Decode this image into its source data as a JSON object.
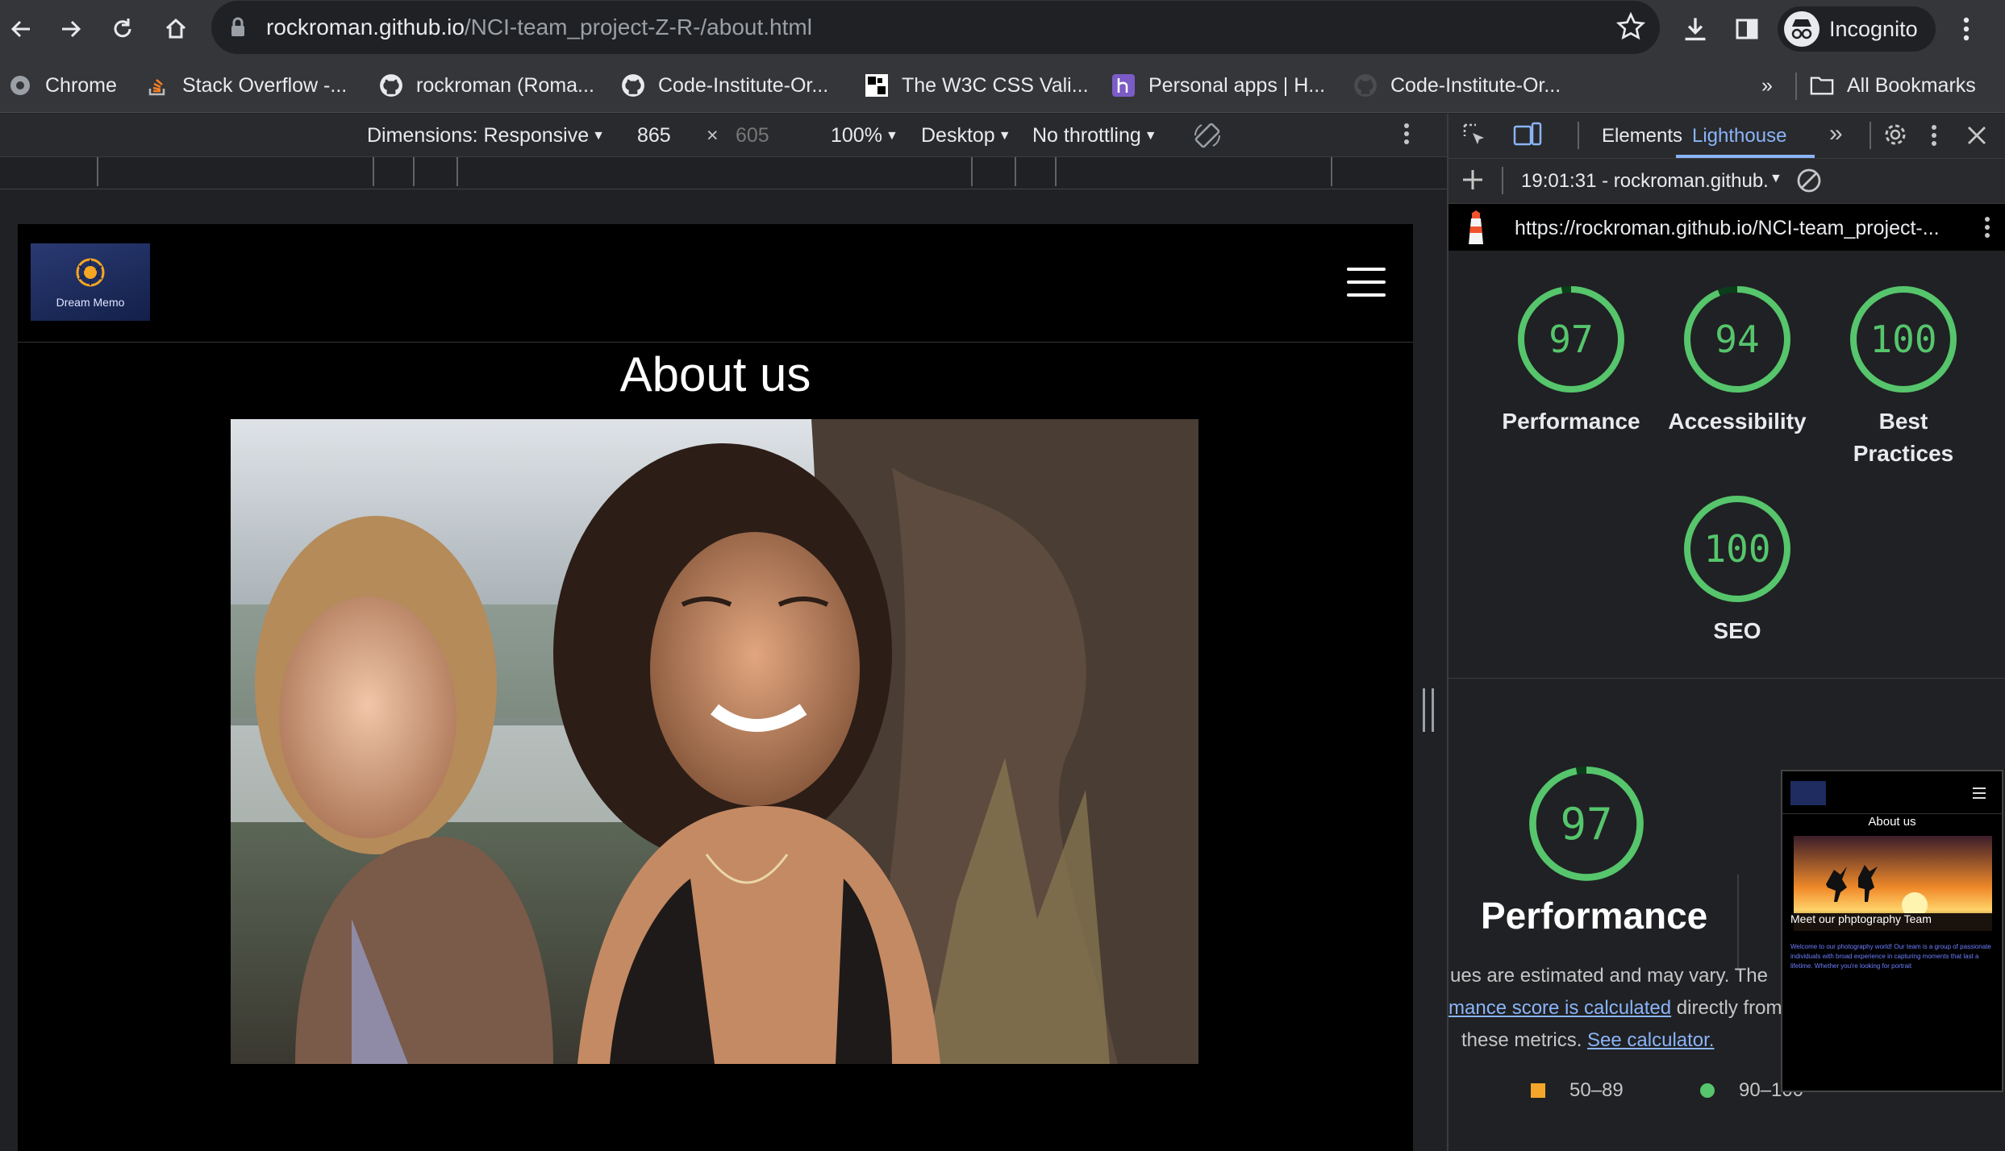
{
  "browser": {
    "url_domain": "rockroman.github.io",
    "url_path": "/NCI-team_project-Z-R-/about.html",
    "profile_label": "Incognito"
  },
  "bookmarks": {
    "items": [
      {
        "label": "Chrome",
        "icon": "chrome-icon"
      },
      {
        "label": "Stack Overflow -...",
        "icon": "stackoverflow-icon"
      },
      {
        "label": "rockroman (Roma...",
        "icon": "github-icon"
      },
      {
        "label": "Code-Institute-Or...",
        "icon": "github-icon"
      },
      {
        "label": "The W3C CSS Vali...",
        "icon": "w3c-icon"
      },
      {
        "label": "Personal apps | H...",
        "icon": "heroku-icon"
      },
      {
        "label": "Code-Institute-Or...",
        "icon": "github-icon"
      }
    ],
    "overflow": "»",
    "all_bookmarks": "All Bookmarks"
  },
  "device_toolbar": {
    "dimensions": "Dimensions: Responsive",
    "width": "865",
    "times": "×",
    "height": "605",
    "zoom": "100%",
    "device_type": "Desktop",
    "throttling": "No throttling"
  },
  "site": {
    "logo_text": "Dream Memo",
    "title": "About us"
  },
  "devtools": {
    "tabs": {
      "elements": "Elements",
      "lighthouse": "Lighthouse",
      "more": "»"
    },
    "report_time": "19:01:31 - rockroman.github.i",
    "report_url": "https://rockroman.github.io/NCI-team_project-...",
    "scores": [
      {
        "value": 97,
        "label": "Performance"
      },
      {
        "value": 94,
        "label": "Accessibility"
      },
      {
        "value": 100,
        "label": "Best Practices"
      },
      {
        "value": 100,
        "label": "SEO"
      }
    ],
    "performance": {
      "score": 97,
      "title": "Performance",
      "desc_1": "ues are estimated and may vary. The",
      "desc_link": "mance score is calculated",
      "desc_2": " directly from",
      "desc_3": "these metrics. ",
      "desc_link2": "See calculator."
    },
    "legend": {
      "mid": "50–89",
      "high": "90–100"
    },
    "thumbnail": {
      "title": "About us",
      "heading": "Meet our phptography Team",
      "body": "Welcome to our photography world! Our team is a group of passionate individuals with broad experience in capturing moments that last a lifetime. Whether you're looking for portrait"
    },
    "colors": {
      "pass": "#56c56c",
      "average": "#f4a62a",
      "link": "#8ab4f8"
    }
  }
}
